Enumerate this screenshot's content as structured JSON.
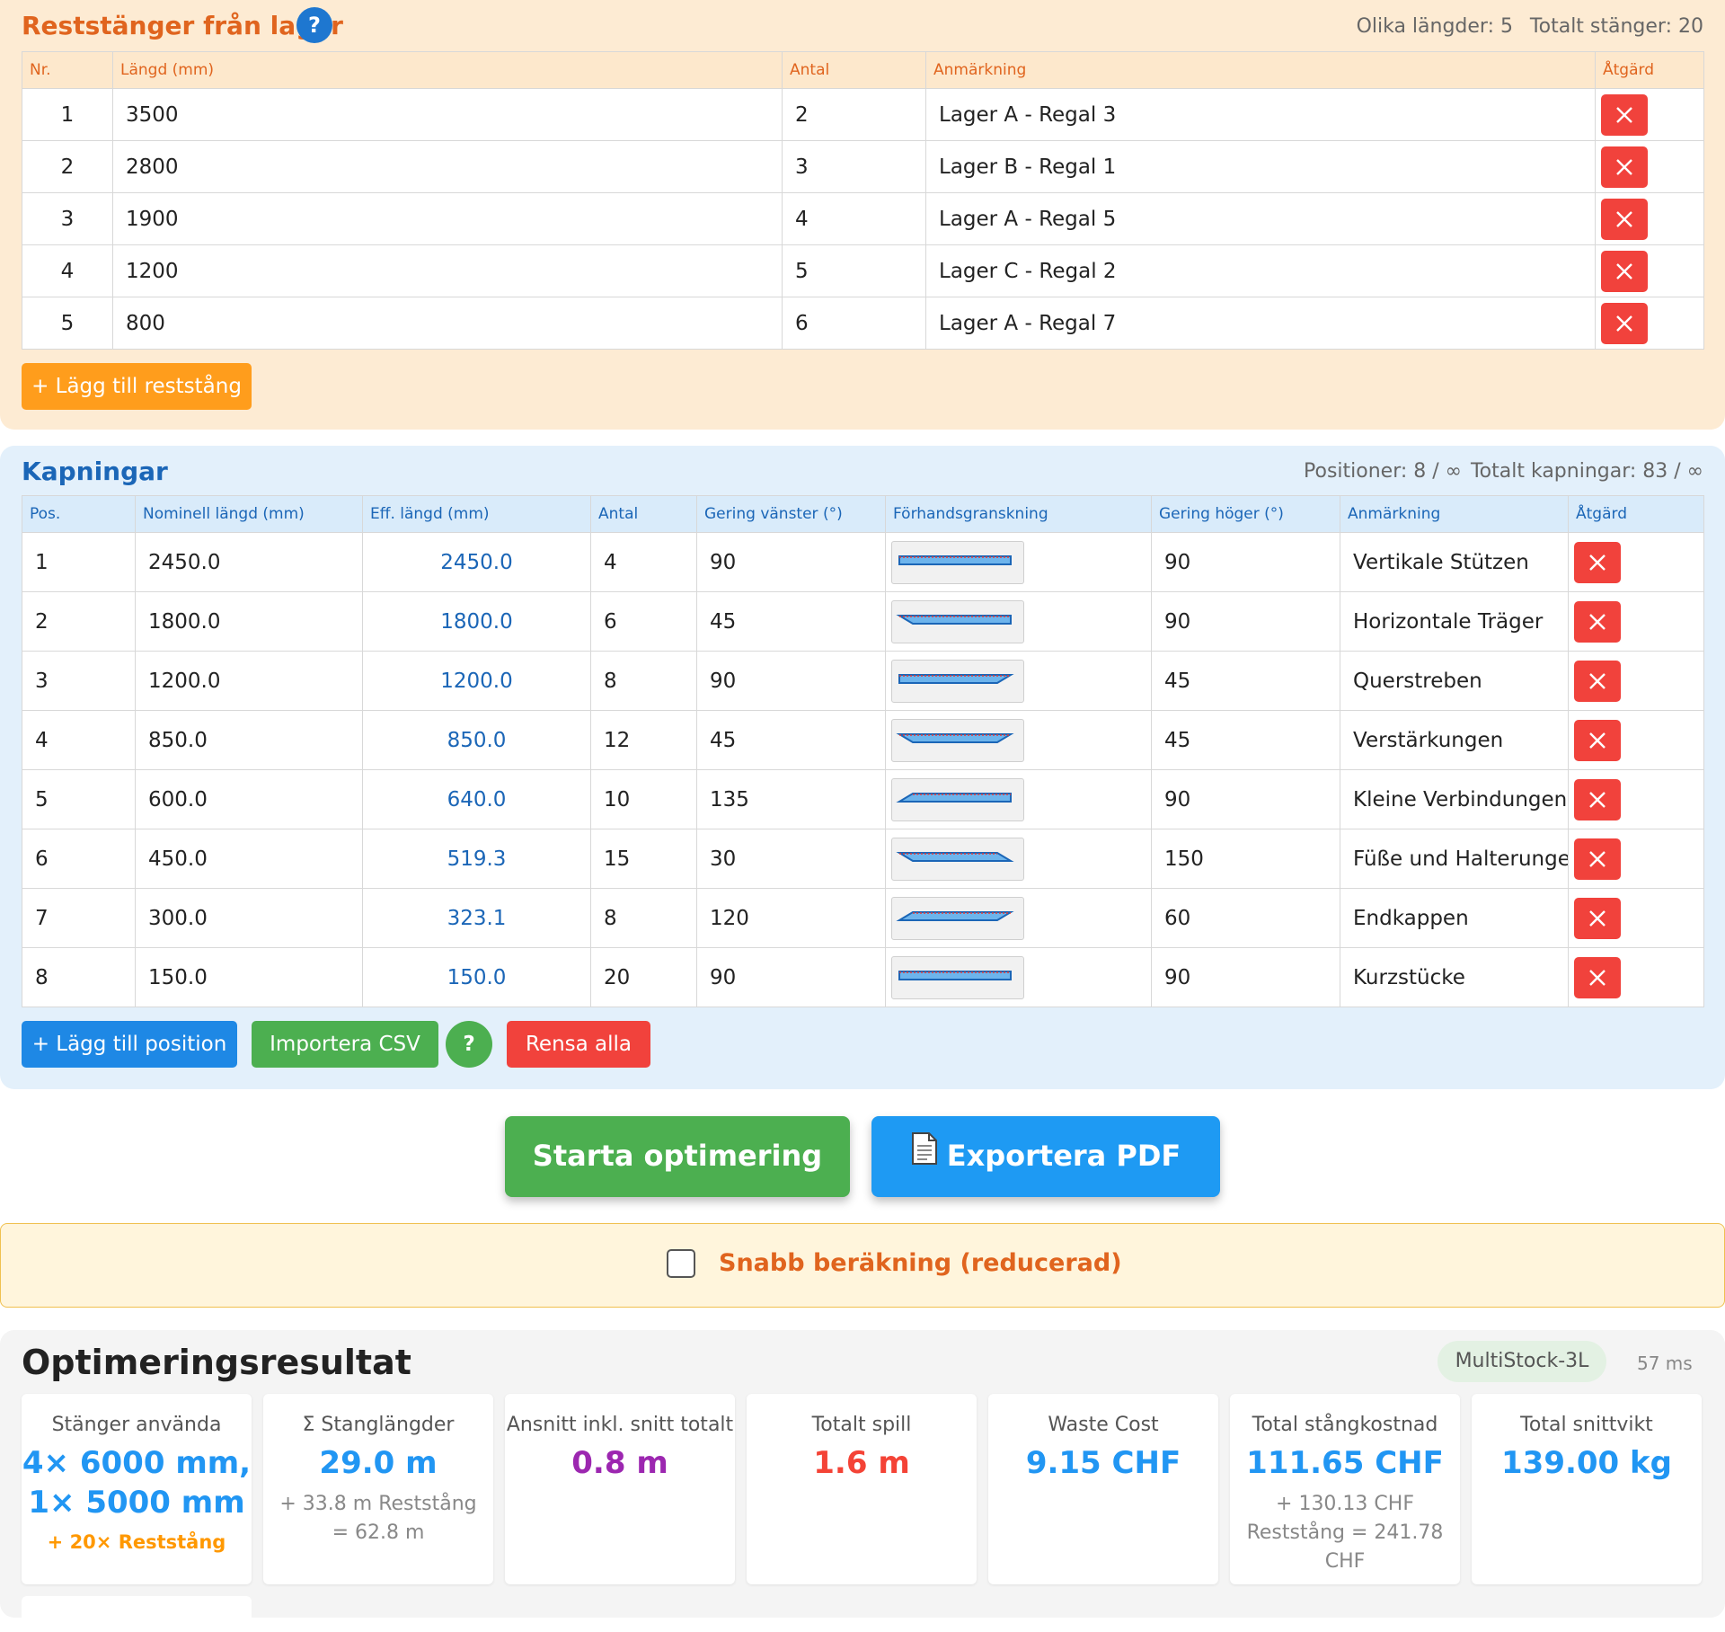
{
  "stock": {
    "title": "Reststänger från lager",
    "help": "?",
    "stat_lengths": "Olika längder: 5",
    "stat_total": "Totalt stänger: 20",
    "columns": [
      "Nr.",
      "Längd (mm)",
      "Antal",
      "Anmärkning",
      "Åtgärd"
    ],
    "rows": [
      {
        "nr": "1",
        "length": "3500",
        "qty": "2",
        "note": "Lager A - Regal 3"
      },
      {
        "nr": "2",
        "length": "2800",
        "qty": "3",
        "note": "Lager B - Regal 1"
      },
      {
        "nr": "3",
        "length": "1900",
        "qty": "4",
        "note": "Lager A - Regal 5"
      },
      {
        "nr": "4",
        "length": "1200",
        "qty": "5",
        "note": "Lager C - Regal 2"
      },
      {
        "nr": "5",
        "length": "800",
        "qty": "6",
        "note": "Lager A - Regal 7"
      }
    ],
    "add_button": "+ Lägg till reststång"
  },
  "cuts": {
    "title": "Kapningar",
    "stat_positions": "Positioner: 8 / ∞",
    "stat_total": "Totalt kapningar: 83 / ∞",
    "columns": [
      "Pos.",
      "Nominell längd (mm)",
      "Eff. längd (mm)",
      "Antal",
      "Gering vänster (°)",
      "Förhandsgranskning",
      "Gering höger (°)",
      "Anmärkning",
      "Åtgärd"
    ],
    "rows": [
      {
        "pos": "1",
        "nominal": "2450.0",
        "eff": "2450.0",
        "qty": "4",
        "left": "90",
        "right": "90",
        "note": "Vertikale Stützen"
      },
      {
        "pos": "2",
        "nominal": "1800.0",
        "eff": "1800.0",
        "qty": "6",
        "left": "45",
        "right": "90",
        "note": "Horizontale Träger"
      },
      {
        "pos": "3",
        "nominal": "1200.0",
        "eff": "1200.0",
        "qty": "8",
        "left": "90",
        "right": "45",
        "note": "Querstreben"
      },
      {
        "pos": "4",
        "nominal": "850.0",
        "eff": "850.0",
        "qty": "12",
        "left": "45",
        "right": "45",
        "note": "Verstärkungen"
      },
      {
        "pos": "5",
        "nominal": "600.0",
        "eff": "640.0",
        "qty": "10",
        "left": "135",
        "right": "90",
        "note": "Kleine Verbindungen"
      },
      {
        "pos": "6",
        "nominal": "450.0",
        "eff": "519.3",
        "qty": "15",
        "left": "30",
        "right": "150",
        "note": "Füße und Halterunge"
      },
      {
        "pos": "7",
        "nominal": "300.0",
        "eff": "323.1",
        "qty": "8",
        "left": "120",
        "right": "60",
        "note": "Endkappen"
      },
      {
        "pos": "8",
        "nominal": "150.0",
        "eff": "150.0",
        "qty": "20",
        "left": "90",
        "right": "90",
        "note": "Kurzstücke"
      }
    ],
    "add_button": "+ Lägg till position",
    "import_button": "Importera CSV",
    "help": "?",
    "clear_button": "Rensa alla"
  },
  "actions": {
    "start": "Starta optimering",
    "export": "Exportera PDF"
  },
  "quick_calc": {
    "label": "Snabb beräkning (reducerad)",
    "checked": false
  },
  "results": {
    "title": "Optimeringsresultat",
    "algorithm": "MultiStock-3L",
    "time": "57 ms",
    "cards": [
      {
        "label": "Stänger använda",
        "value_line1": "4× 6000 mm,",
        "value_line2": "1× 5000 mm",
        "extra": "+ 20× Reststång"
      },
      {
        "label": "Σ Stanglängder",
        "value": "29.0 m",
        "sub": "+ 33.8 m Reststång = 62.8 m"
      },
      {
        "label": "Ansnitt inkl. snitt totalt",
        "value": "0.8 m"
      },
      {
        "label": "Totalt spill",
        "value": "1.6 m"
      },
      {
        "label": "Waste Cost",
        "value": "9.15 CHF"
      },
      {
        "label": "Total stångkostnad",
        "value": "111.65 CHF",
        "sub": "+ 130.13 CHF Reststång = 241.78 CHF"
      },
      {
        "label": "Total snittvikt",
        "value": "139.00 kg"
      }
    ]
  },
  "colors": {
    "orange": "#e0641e",
    "blue": "#1b66b7",
    "green": "#4caf50",
    "red": "#f1423c",
    "purple": "#9c27b0"
  }
}
